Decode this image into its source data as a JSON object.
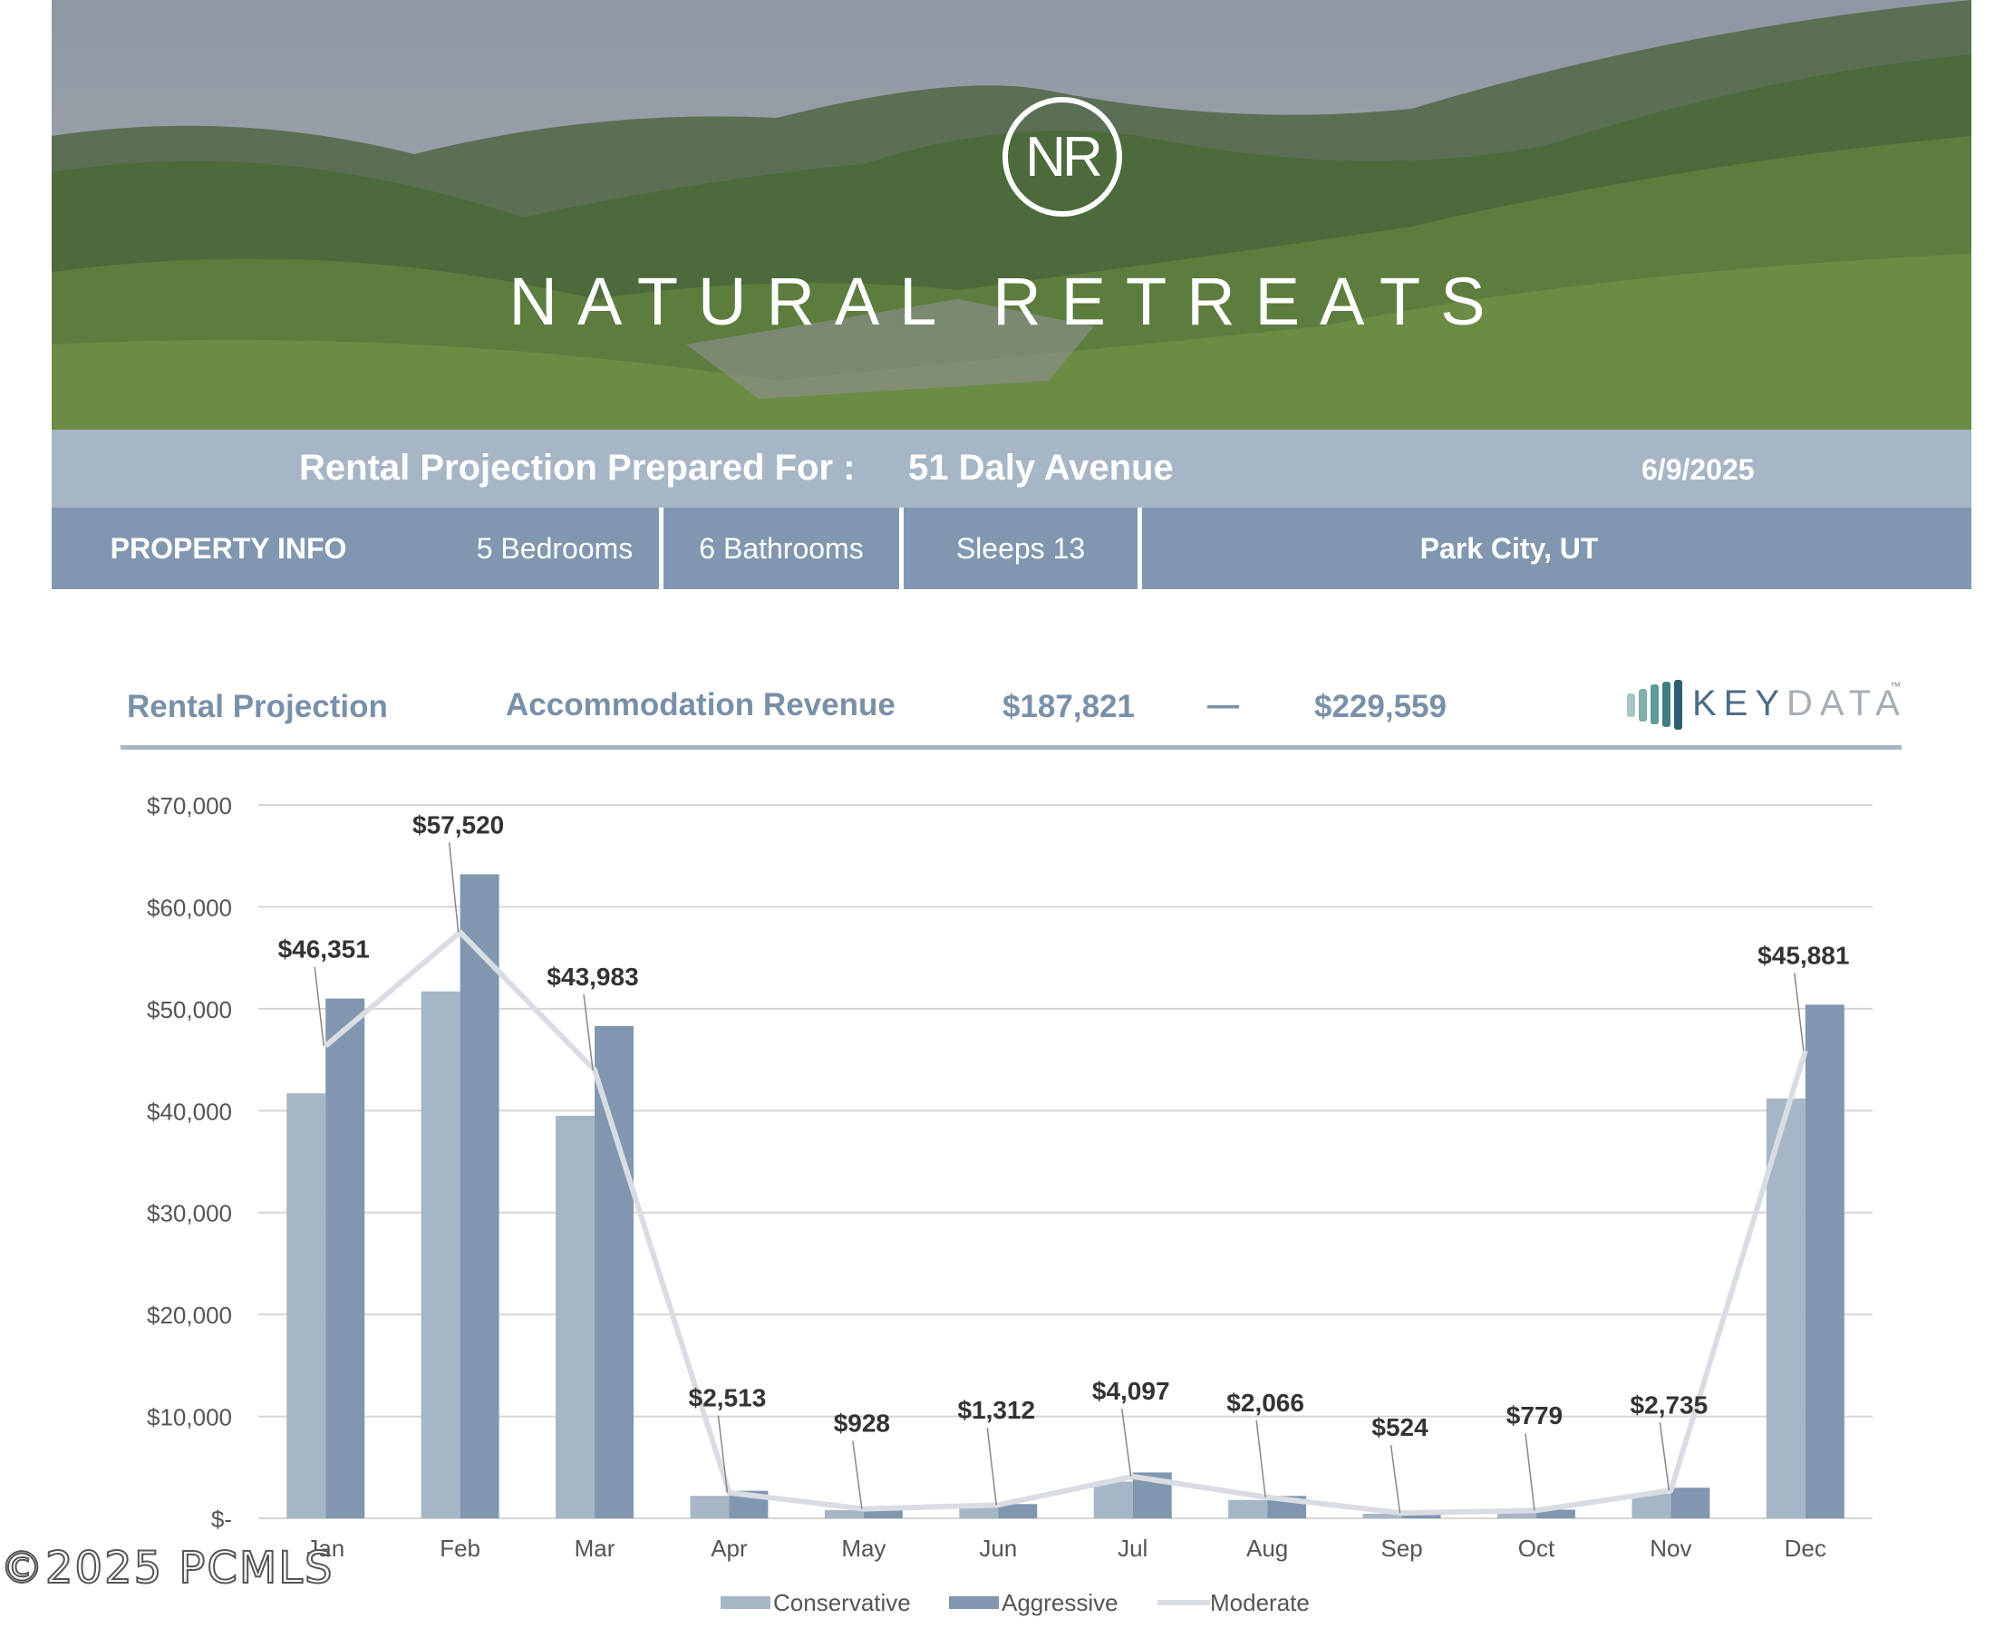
{
  "hero": {
    "logo_text": "NR",
    "brand_name": "NATURAL RETREATS"
  },
  "header": {
    "prepared_label": "Rental Projection Prepared For :",
    "address": "51 Daly Avenue",
    "date": "6/9/2025"
  },
  "property": {
    "section_label": "PROPERTY INFO",
    "bedrooms": "5 Bedrooms",
    "bathrooms": "6 Bathrooms",
    "sleeps": "Sleeps 13",
    "location": "Park City, UT"
  },
  "projection": {
    "title": "Rental Projection",
    "revenue_label": "Accommodation Revenue",
    "low": "$187,821",
    "dash": "—",
    "high": "$229,559",
    "provider_a": "KEY",
    "provider_b": "DATA",
    "provider_tm": "™"
  },
  "watermark": "©2025 PCMLS",
  "colors": {
    "conservative": "#a7b6c6",
    "aggressive": "#8197b0",
    "moderate": "#d9dde3",
    "header_band": "#a7b6c6",
    "info_band": "#8197b0"
  },
  "chart_data": {
    "type": "bar",
    "categories": [
      "Jan",
      "Feb",
      "Mar",
      "Apr",
      "May",
      "Jun",
      "Jul",
      "Aug",
      "Sep",
      "Oct",
      "Nov",
      "Dec"
    ],
    "series": [
      {
        "name": "Conservative",
        "type": "bar",
        "values": [
          41700,
          51700,
          39500,
          2200,
          800,
          1100,
          3600,
          1800,
          450,
          650,
          2400,
          41200
        ]
      },
      {
        "name": "Aggressive",
        "type": "bar",
        "values": [
          51000,
          63200,
          48300,
          2700,
          1000,
          1400,
          4500,
          2200,
          580,
          850,
          3000,
          50400
        ]
      },
      {
        "name": "Moderate",
        "type": "line",
        "values": [
          46351,
          57520,
          43983,
          2513,
          928,
          1312,
          4097,
          2066,
          524,
          779,
          2735,
          45881
        ]
      }
    ],
    "data_labels": [
      "$46,351",
      "$57,520",
      "$43,983",
      "$2,513",
      "$928",
      "$1,312",
      "$4,097",
      "$2,066",
      "$524",
      "$779",
      "$2,735",
      "$45,881"
    ],
    "y_ticks": [
      "$-",
      "$10,000",
      "$20,000",
      "$30,000",
      "$40,000",
      "$50,000",
      "$60,000",
      "$70,000"
    ],
    "ylim": [
      0,
      70000
    ],
    "grid": true,
    "legend_position": "bottom",
    "title": "",
    "xlabel": "",
    "ylabel": ""
  }
}
